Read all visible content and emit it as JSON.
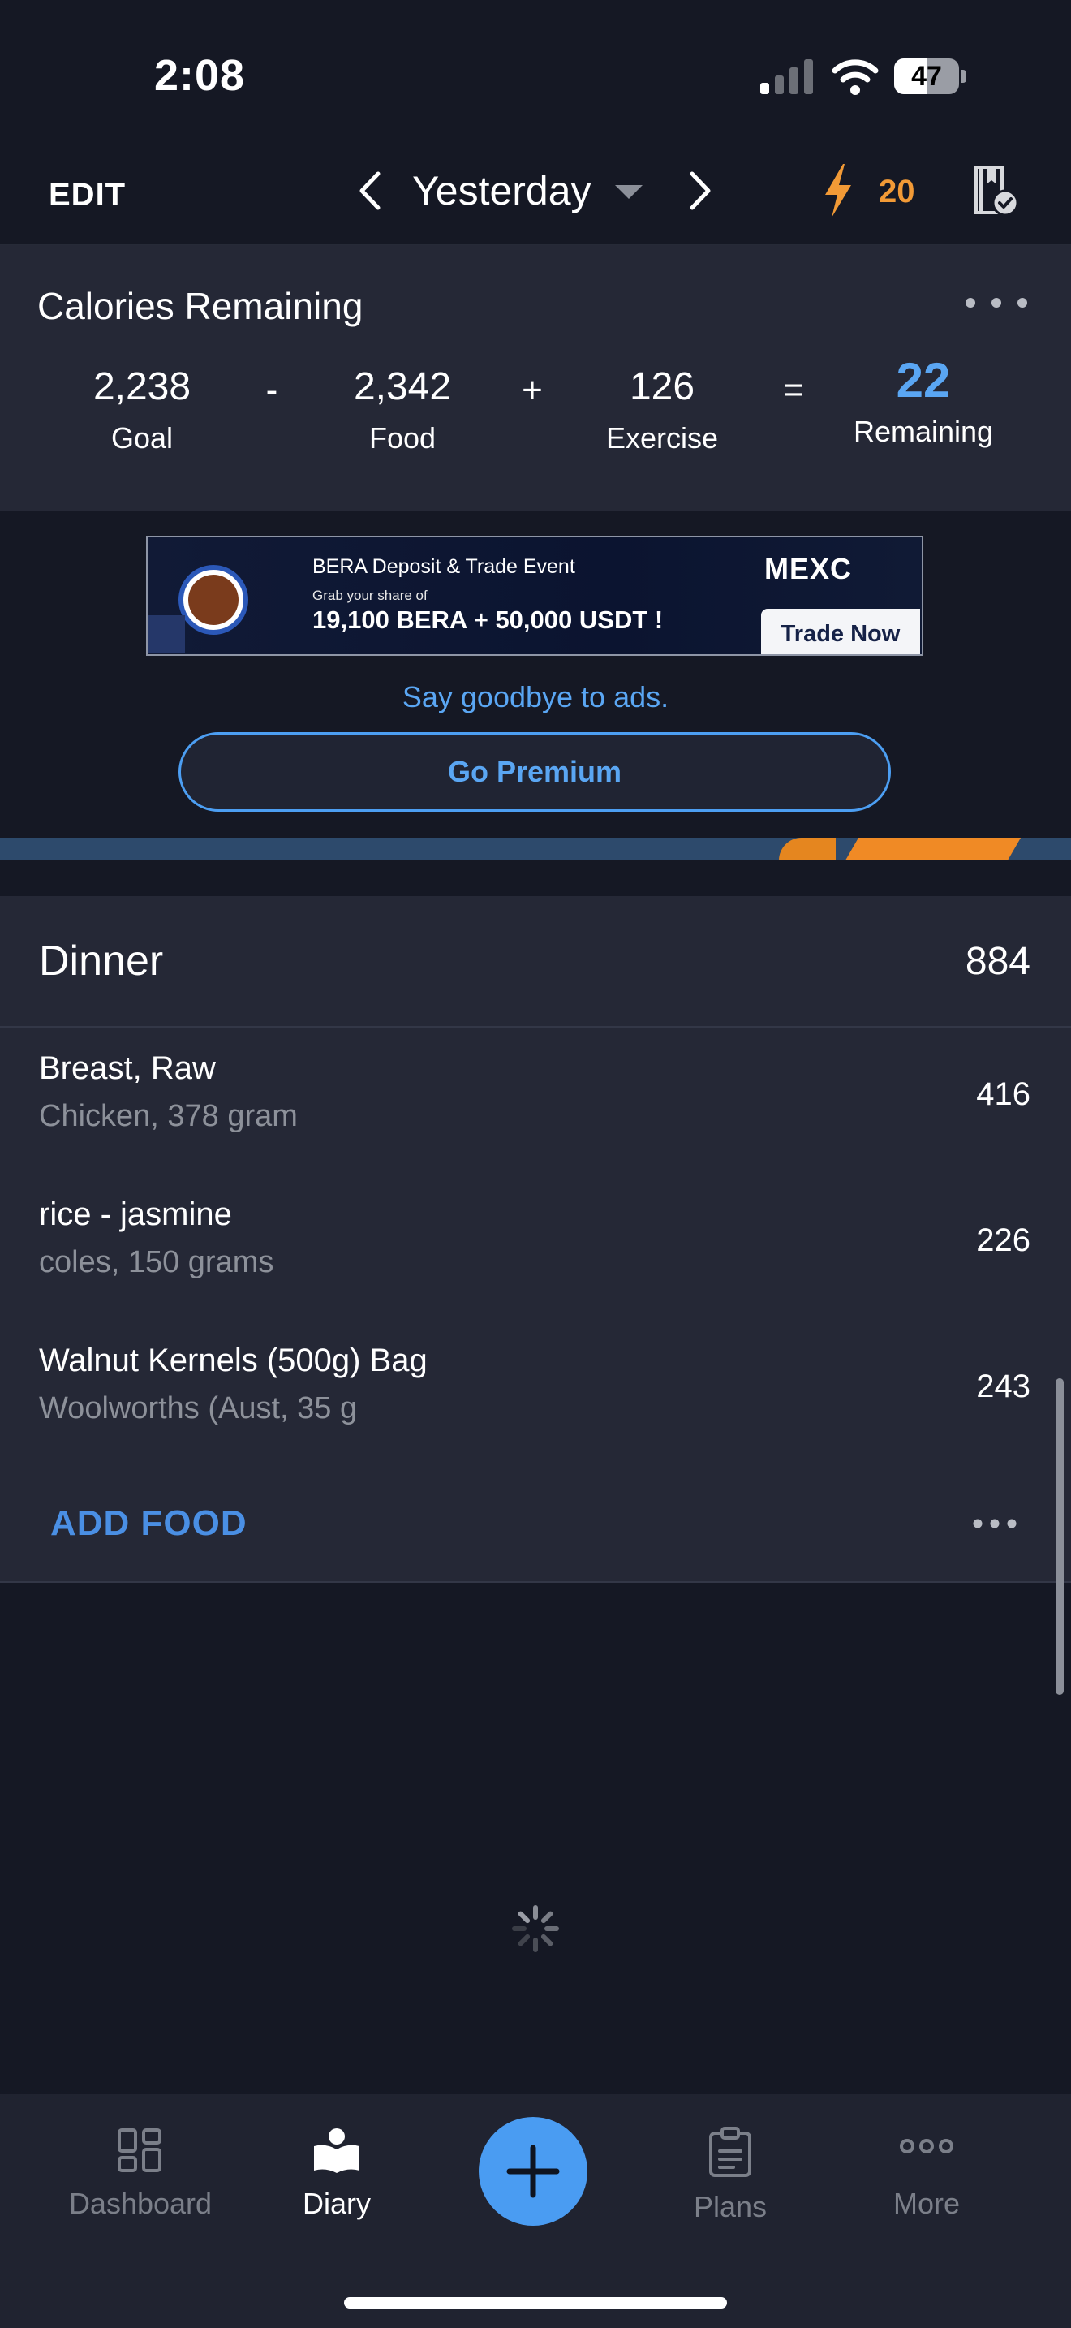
{
  "status_bar": {
    "time": "2:08",
    "battery": "47"
  },
  "top_bar": {
    "edit_label": "EDIT",
    "date_label": "Yesterday",
    "streak_count": "20"
  },
  "calories": {
    "title": "Calories Remaining",
    "goal": {
      "value": "2,238",
      "label": "Goal"
    },
    "op_minus": "-",
    "food": {
      "value": "2,342",
      "label": "Food"
    },
    "op_plus": "+",
    "exercise": {
      "value": "126",
      "label": "Exercise"
    },
    "op_equals": "=",
    "remaining": {
      "value": "22",
      "label": "Remaining"
    }
  },
  "ad": {
    "line1": "BERA Deposit & Trade Event",
    "line2": "Grab your share of",
    "line3": "19,100 BERA + 50,000 USDT !",
    "brand": "MEXC",
    "cta": "Trade Now"
  },
  "promo": {
    "goodbye_text": "Say goodbye to ads.",
    "premium_label": "Go Premium"
  },
  "dinner": {
    "title": "Dinner",
    "total": "884",
    "items": [
      {
        "name": "Breast, Raw",
        "desc": "Chicken, 378 gram",
        "cal": "416"
      },
      {
        "name": "rice - jasmine",
        "desc": "coles, 150 grams",
        "cal": "226"
      },
      {
        "name": "Walnut Kernels (500g) Bag",
        "desc": "Woolworths (Aust, 35 g",
        "cal": "243"
      }
    ],
    "add_food_label": "ADD FOOD"
  },
  "tab_bar": {
    "dashboard": "Dashboard",
    "diary": "Diary",
    "plans": "Plans",
    "more": "More"
  },
  "colors": {
    "accent": "#4a9cf2",
    "remaining": "#5aa6f3",
    "streak": "#f29a36"
  },
  "icons": [
    "signal-icon",
    "wifi-icon",
    "battery-icon",
    "chevron-left-icon",
    "chevron-right-icon",
    "dropdown-caret-icon",
    "bolt-icon",
    "diary-check-icon",
    "more-dots-icon",
    "spinner-icon",
    "dashboard-icon",
    "diary-icon",
    "plus-icon",
    "plans-icon",
    "more-icon"
  ]
}
